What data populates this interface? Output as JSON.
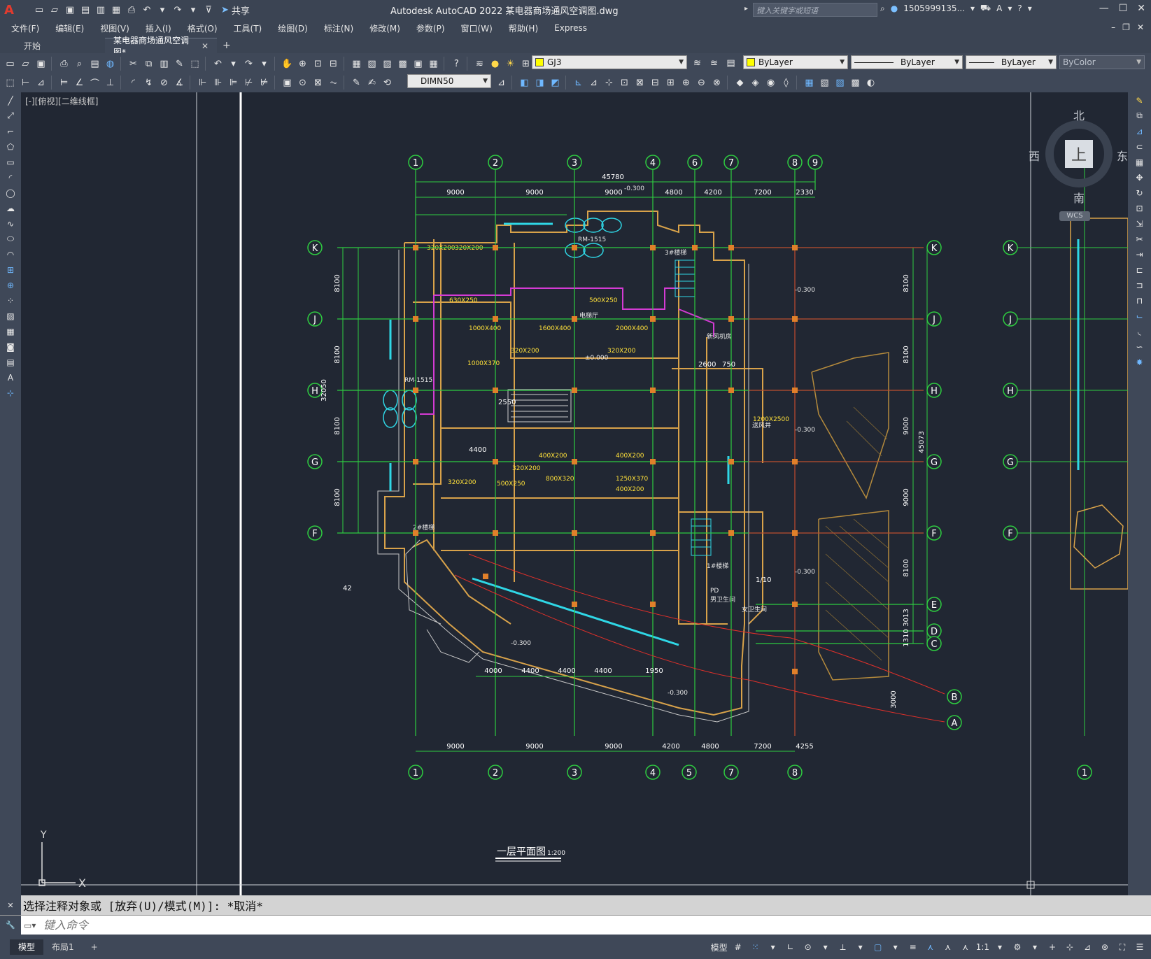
{
  "app": {
    "title": "Autodesk AutoCAD 2022    某电器商场通风空调图.dwg",
    "share_label": "共享",
    "search_placeholder": "键入关键字或短语",
    "user": "1505999135...",
    "logo": "A"
  },
  "menu": [
    "文件(F)",
    "编辑(E)",
    "视图(V)",
    "插入(I)",
    "格式(O)",
    "工具(T)",
    "绘图(D)",
    "标注(N)",
    "修改(M)",
    "参数(P)",
    "窗口(W)",
    "帮助(H)",
    "Express"
  ],
  "tabs": {
    "start": "开始",
    "active": "某电器商场通风空调图*",
    "close": "✕",
    "plus": "+"
  },
  "toolbar": {
    "layer": "GJ3",
    "color": "ByLayer",
    "linetype": "ByLayer",
    "lineweight": "ByLayer",
    "plotstyle": "ByColor",
    "dimstyle": "DIMN50"
  },
  "viewport": {
    "label": "[-][俯视][二维线框]",
    "cube_top": "上",
    "north": "北",
    "south": "南",
    "east": "东",
    "west": "西",
    "wcs": "WCS"
  },
  "drawing": {
    "plan_title": "一层平面图",
    "plan_scale": "1:200",
    "ucs_x": "X",
    "ucs_y": "Y",
    "grid_top": [
      "1",
      "2",
      "3",
      "4",
      "6",
      "7",
      "8",
      "9"
    ],
    "grid_bottom": [
      "1",
      "2",
      "3",
      "4",
      "5",
      "7",
      "8"
    ],
    "grid_rows": [
      "K",
      "J",
      "H",
      "G",
      "F",
      "E",
      "D",
      "C",
      "B",
      "A"
    ],
    "dims_top": [
      "9000",
      "9000",
      "9000",
      "4800",
      "4200",
      "7200",
      "2330"
    ],
    "dims_bottom": [
      "9000",
      "9000",
      "9000",
      "4200",
      "4800",
      "7200",
      "4255"
    ],
    "dim_total_top": "45780",
    "dims_left": [
      "8100",
      "8100",
      "8100",
      "8100"
    ],
    "dim_total_left": "32050",
    "dims_right": [
      "8100",
      "8100",
      "9000",
      "9000",
      "8100",
      "3013",
      "1310",
      "3000"
    ],
    "dim_total_right": "45073",
    "dims_lower": [
      "4000",
      "4400",
      "4400",
      "4400",
      "1950"
    ],
    "duct_labels": [
      "320X200",
      "320X200",
      "630X250",
      "500X250",
      "1000X400",
      "1600X400",
      "2000X400",
      "320X200",
      "320X200",
      "1000X370",
      "400X200",
      "320X200",
      "320X200",
      "500X250",
      "800X320",
      "1250X370",
      "400X200",
      "400X200",
      "1200X2500"
    ],
    "room_labels": [
      "RM-1515",
      "RM-1515",
      "3#楼梯",
      "1#楼梯",
      "2#楼梯",
      "电梯厅",
      "新风机房",
      "PD",
      "男卫生间",
      "女卫生间",
      "送风井"
    ],
    "levels": [
      "-0.300",
      "-0.300",
      "-0.300",
      "-0.300",
      "-0.300",
      "-0.300",
      "±0.000"
    ],
    "misc": [
      "42",
      "1/10",
      "2550",
      "4400",
      "2600",
      "750"
    ]
  },
  "command": {
    "history": "选择注释对象或 [放弃(U)/模式(M)]: *取消*",
    "placeholder": "键入命令"
  },
  "status": {
    "model_tab": "模型",
    "layout_tab": "布局1",
    "add_tab": "+",
    "model_btn": "模型",
    "scale": "1:1"
  }
}
